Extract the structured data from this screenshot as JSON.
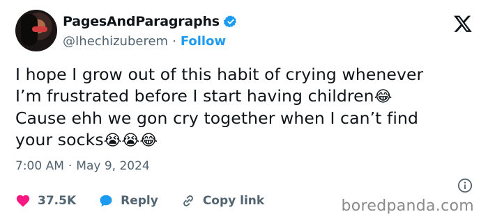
{
  "author": {
    "display_name": "PagesAndParagraphs",
    "handle": "@Ihechizuberem",
    "separator": "·",
    "follow_label": "Follow"
  },
  "tweet": {
    "lines": [
      "I hope I grow out of this habit of crying whenever",
      "I’m frustrated before I start having children",
      "Cause ehh we gon cry together when I can’t find",
      "your socks"
    ],
    "emoji_line2": "😂",
    "emoji_line4": "😭😭😂"
  },
  "meta": {
    "time": "7:00 AM",
    "separator": "·",
    "date": "May 9, 2024"
  },
  "actions": {
    "likes": "37.5K",
    "reply_label": "Reply",
    "copy_link_label": "Copy link"
  },
  "watermark": "boredpanda.com",
  "colors": {
    "accent": "#1d9bf0",
    "like": "#f91880",
    "muted": "#536471",
    "text": "#0f1419"
  }
}
